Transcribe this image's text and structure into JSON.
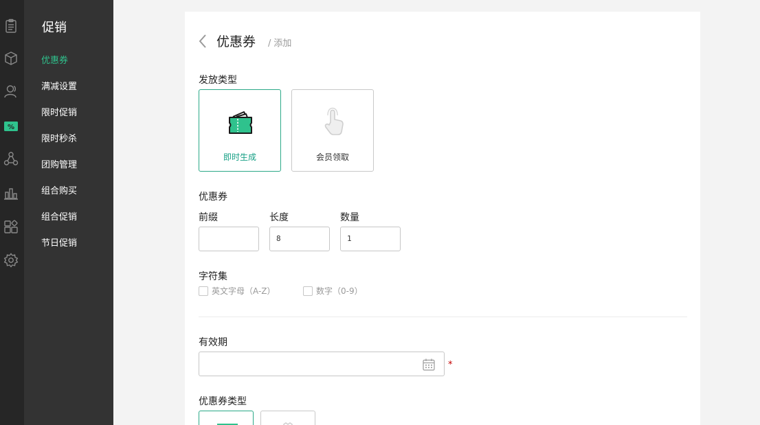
{
  "nav": {
    "title": "促销",
    "items": [
      {
        "label": "优惠券",
        "active": true
      },
      {
        "label": "满减设置"
      },
      {
        "label": "限时促销"
      },
      {
        "label": "限时秒杀"
      },
      {
        "label": "团购管理"
      },
      {
        "label": "组合购买"
      },
      {
        "label": "组合促销"
      },
      {
        "label": "节日促销"
      }
    ]
  },
  "rail_icons": [
    "orders-icon",
    "product-box-icon",
    "member-icon",
    "promotion-icon",
    "distribution-icon",
    "statistics-icon",
    "apps-icon",
    "settings-icon"
  ],
  "header": {
    "title": "优惠券",
    "crumb_sep": "/",
    "crumb": "添加"
  },
  "form": {
    "issue_type_label": "发放类型",
    "issue_types": [
      {
        "label": "即时生成",
        "icon": "coupon-ticket-icon",
        "selected": true
      },
      {
        "label": "会员领取",
        "icon": "hand-pointer-icon",
        "selected": false
      }
    ],
    "coupon_section_label": "优惠券",
    "prefix_label": "前缀",
    "prefix_value": "",
    "length_label": "长度",
    "length_value": "8",
    "quantity_label": "数量",
    "quantity_value": "1",
    "charset_label": "字符集",
    "charset_options": [
      {
        "label": "英文字母（A-Z）",
        "checked": false
      },
      {
        "label": "数字（0-9）",
        "checked": false
      }
    ],
    "validity_label": "有效期",
    "validity_value": "",
    "required_mark": "*",
    "coupon_type_label": "优惠券类型"
  },
  "colors": {
    "accent": "#2fc28d",
    "selected_border": "#2aa887",
    "rail_bg": "#262626",
    "subnav_bg": "#333333"
  }
}
